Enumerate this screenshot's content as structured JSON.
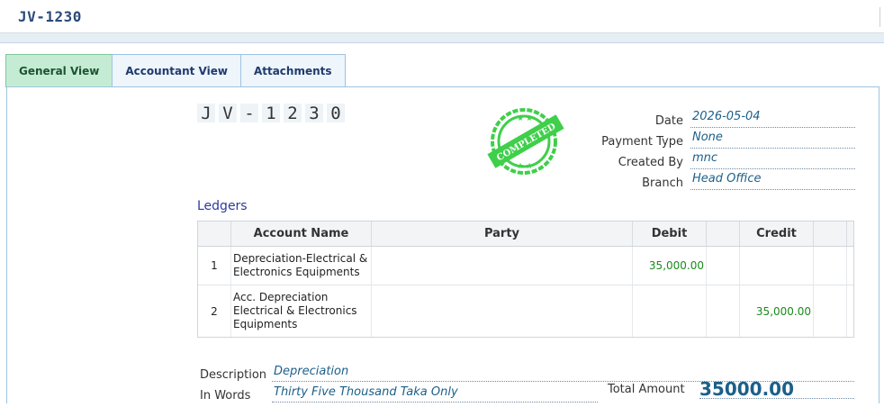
{
  "window": {
    "title": "JV-1230"
  },
  "tabs": [
    {
      "label": "General View",
      "active": true
    },
    {
      "label": "Accountant View",
      "active": false
    },
    {
      "label": "Attachments",
      "active": false
    }
  ],
  "voucher": {
    "number_chars": [
      "J",
      "V",
      "-",
      "1",
      "2",
      "3",
      "0"
    ],
    "stamp_text": "COMPLETED",
    "stamp_color": "#3fcf4a"
  },
  "info": {
    "date_label": "Date",
    "date_value": "2026-05-04",
    "payment_type_label": "Payment Type",
    "payment_type_value": "None",
    "created_by_label": "Created By",
    "created_by_value": "mnc",
    "branch_label": "Branch",
    "branch_value": "Head Office"
  },
  "ledgers": {
    "title": "Ledgers",
    "columns": {
      "num": "",
      "account": "Account Name",
      "party": "Party",
      "debit": "Debit",
      "credit": "Credit"
    },
    "rows": [
      {
        "num": "1",
        "account": "Depreciation-Electrical & Electronics Equipments",
        "party": "",
        "debit": "35,000.00",
        "credit": ""
      },
      {
        "num": "2",
        "account": "Acc. Depreciation Electrical & Electronics Equipments",
        "party": "",
        "debit": "",
        "credit": "35,000.00"
      }
    ]
  },
  "footer": {
    "description_label": "Description",
    "description_value": "Depreciation",
    "in_words_label": "In Words",
    "in_words_value": "Thirty Five Thousand Taka Only",
    "total_label": "Total Amount",
    "total_value": "35000.00"
  },
  "colors": {
    "accent": "#1c5f8a",
    "positive_amount": "#1a8a1a",
    "active_tab": "#c4ecd4"
  }
}
